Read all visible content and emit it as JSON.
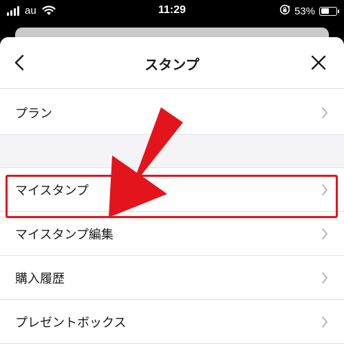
{
  "status_bar": {
    "carrier": "au",
    "time": "11:29",
    "battery_percent_text": "53%",
    "battery_level": 0.53,
    "icons": [
      "signal-icon",
      "wifi-icon",
      "rotation-lock-icon",
      "battery-icon"
    ]
  },
  "nav": {
    "title": "スタンプ",
    "back_icon": "chevron-left-icon",
    "close_icon": "close-icon"
  },
  "list": {
    "items": [
      {
        "label": "プラン"
      },
      {
        "label": "マイスタンプ"
      },
      {
        "label": "マイスタンプ編集"
      },
      {
        "label": "購入履歴"
      },
      {
        "label": "プレゼントボックス"
      }
    ],
    "highlighted_item": "マイスタンプ編集"
  },
  "colors": {
    "annotation_red": "#e4141c",
    "background": "#ffffff",
    "section_gap": "#f4f4f6",
    "chevron": "#b5b5b5"
  }
}
